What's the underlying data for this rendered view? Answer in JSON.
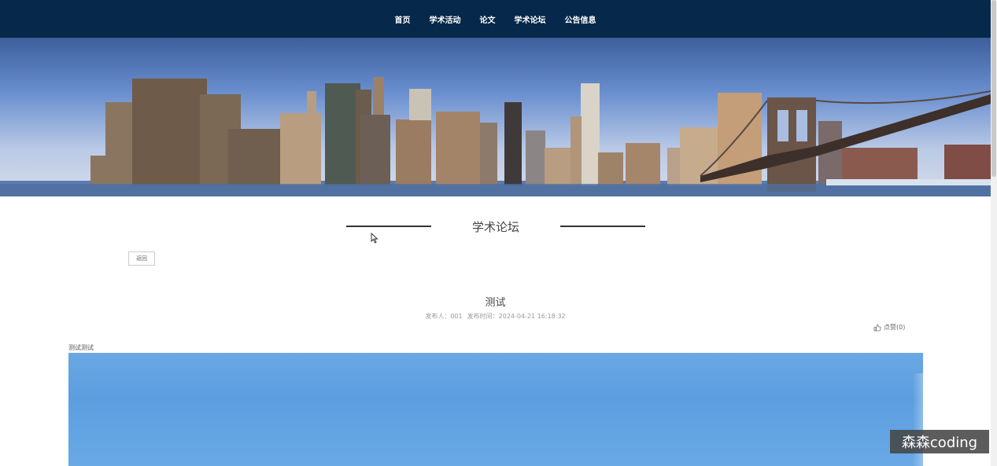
{
  "nav": {
    "items": [
      "首页",
      "学术活动",
      "论文",
      "学术论坛",
      "公告信息"
    ]
  },
  "section": {
    "title": "学术论坛"
  },
  "back_button": {
    "label": "返回"
  },
  "post": {
    "title": "测试",
    "author_label": "发布人：001",
    "time_label": "发布时间：2024-04-21 16:18:32",
    "like_label": "点赞(0)",
    "content": "测试测试"
  },
  "watermark": {
    "text": "森森coding"
  },
  "colors": {
    "topbar": "#06284a",
    "image_sky": "#6aa7e3"
  },
  "icons": {
    "like": "thumbs-up-icon",
    "cursor": "mouse-pointer-icon"
  }
}
